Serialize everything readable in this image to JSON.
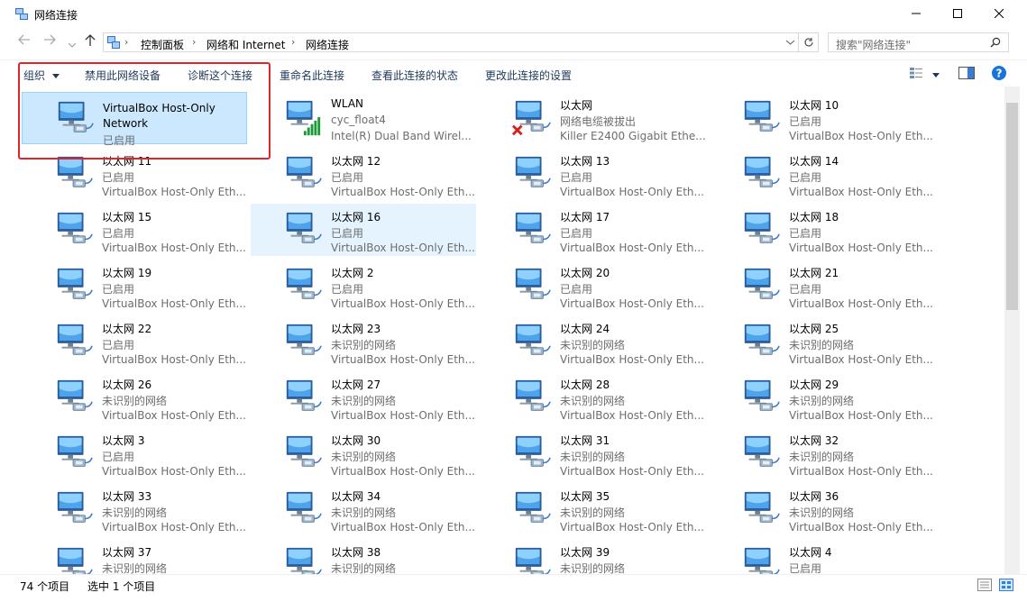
{
  "window": {
    "title": "网络连接",
    "controls": [
      "minimize",
      "maximize",
      "close"
    ]
  },
  "address": {
    "crumbs": [
      "控制面板",
      "网络和 Internet",
      "网络连接"
    ],
    "search_placeholder": "搜索\"网络连接\""
  },
  "toolbar": {
    "organize": "组织",
    "disable": "禁用此网络设备",
    "diagnose": "诊断这个连接",
    "rename": "重命名此连接",
    "view_status": "查看此连接的状态",
    "change_settings": "更改此连接的设置"
  },
  "connections": [
    {
      "name": "VirtualBox Host-Only Network",
      "name2": "",
      "status": "已启用",
      "device": "",
      "type": "ethernet",
      "state": "selected"
    },
    {
      "name": "WLAN",
      "status": "cyc_float4",
      "device": "Intel(R) Dual Band Wirel...",
      "type": "wifi"
    },
    {
      "name": "以太网",
      "status": "网络电缆被拔出",
      "device": "Killer E2400 Gigabit Ethe...",
      "type": "disconnected"
    },
    {
      "name": "以太网 10",
      "status": "已启用",
      "device": "VirtualBox Host-Only Eth...",
      "type": "ethernet"
    },
    {
      "name": "以太网 11",
      "status": "已启用",
      "device": "VirtualBox Host-Only Eth...",
      "type": "ethernet"
    },
    {
      "name": "以太网 12",
      "status": "已启用",
      "device": "VirtualBox Host-Only Eth...",
      "type": "ethernet"
    },
    {
      "name": "以太网 13",
      "status": "已启用",
      "device": "VirtualBox Host-Only Eth...",
      "type": "ethernet"
    },
    {
      "name": "以太网 14",
      "status": "已启用",
      "device": "VirtualBox Host-Only Eth...",
      "type": "ethernet"
    },
    {
      "name": "以太网 15",
      "status": "已启用",
      "device": "VirtualBox Host-Only Eth...",
      "type": "ethernet"
    },
    {
      "name": "以太网 16",
      "status": "已启用",
      "device": "VirtualBox Host-Only Eth...",
      "type": "ethernet",
      "state": "hover"
    },
    {
      "name": "以太网 17",
      "status": "已启用",
      "device": "VirtualBox Host-Only Eth...",
      "type": "ethernet"
    },
    {
      "name": "以太网 18",
      "status": "已启用",
      "device": "VirtualBox Host-Only Eth...",
      "type": "ethernet"
    },
    {
      "name": "以太网 19",
      "status": "已启用",
      "device": "VirtualBox Host-Only Eth...",
      "type": "ethernet"
    },
    {
      "name": "以太网 2",
      "status": "已启用",
      "device": "VirtualBox Host-Only Eth...",
      "type": "ethernet"
    },
    {
      "name": "以太网 20",
      "status": "已启用",
      "device": "VirtualBox Host-Only Eth...",
      "type": "ethernet"
    },
    {
      "name": "以太网 21",
      "status": "已启用",
      "device": "VirtualBox Host-Only Eth...",
      "type": "ethernet"
    },
    {
      "name": "以太网 22",
      "status": "已启用",
      "device": "VirtualBox Host-Only Eth...",
      "type": "ethernet"
    },
    {
      "name": "以太网 23",
      "status": "未识别的网络",
      "device": "VirtualBox Host-Only Eth...",
      "type": "ethernet"
    },
    {
      "name": "以太网 24",
      "status": "未识别的网络",
      "device": "VirtualBox Host-Only Eth...",
      "type": "ethernet"
    },
    {
      "name": "以太网 25",
      "status": "未识别的网络",
      "device": "VirtualBox Host-Only Eth...",
      "type": "ethernet"
    },
    {
      "name": "以太网 26",
      "status": "未识别的网络",
      "device": "VirtualBox Host-Only Eth...",
      "type": "ethernet"
    },
    {
      "name": "以太网 27",
      "status": "未识别的网络",
      "device": "VirtualBox Host-Only Eth...",
      "type": "ethernet"
    },
    {
      "name": "以太网 28",
      "status": "未识别的网络",
      "device": "VirtualBox Host-Only Eth...",
      "type": "ethernet"
    },
    {
      "name": "以太网 29",
      "status": "未识别的网络",
      "device": "VirtualBox Host-Only Eth...",
      "type": "ethernet"
    },
    {
      "name": "以太网 3",
      "status": "已启用",
      "device": "VirtualBox Host-Only Eth...",
      "type": "ethernet"
    },
    {
      "name": "以太网 30",
      "status": "未识别的网络",
      "device": "VirtualBox Host-Only Eth...",
      "type": "ethernet"
    },
    {
      "name": "以太网 31",
      "status": "未识别的网络",
      "device": "VirtualBox Host-Only Eth...",
      "type": "ethernet"
    },
    {
      "name": "以太网 32",
      "status": "未识别的网络",
      "device": "VirtualBox Host-Only Eth...",
      "type": "ethernet"
    },
    {
      "name": "以太网 33",
      "status": "未识别的网络",
      "device": "VirtualBox Host-Only Eth...",
      "type": "ethernet"
    },
    {
      "name": "以太网 34",
      "status": "未识别的网络",
      "device": "VirtualBox Host-Only Eth...",
      "type": "ethernet"
    },
    {
      "name": "以太网 35",
      "status": "未识别的网络",
      "device": "VirtualBox Host-Only Eth...",
      "type": "ethernet"
    },
    {
      "name": "以太网 36",
      "status": "未识别的网络",
      "device": "VirtualBox Host-Only Eth...",
      "type": "ethernet"
    },
    {
      "name": "以太网 37",
      "status": "未识别的网络",
      "device": "",
      "type": "ethernet"
    },
    {
      "name": "以太网 38",
      "status": "未识别的网络",
      "device": "",
      "type": "ethernet"
    },
    {
      "name": "以太网 39",
      "status": "未识别的网络",
      "device": "",
      "type": "ethernet"
    },
    {
      "name": "以太网 4",
      "status": "已启用",
      "device": "",
      "type": "ethernet"
    }
  ],
  "statusbar": {
    "count": "74 个项目",
    "selected": "选中 1 个项目"
  },
  "colors": {
    "selection_bg": "#cce8ff",
    "highlight_border": "#e0242c",
    "toolbar_text": "#1e395b"
  }
}
